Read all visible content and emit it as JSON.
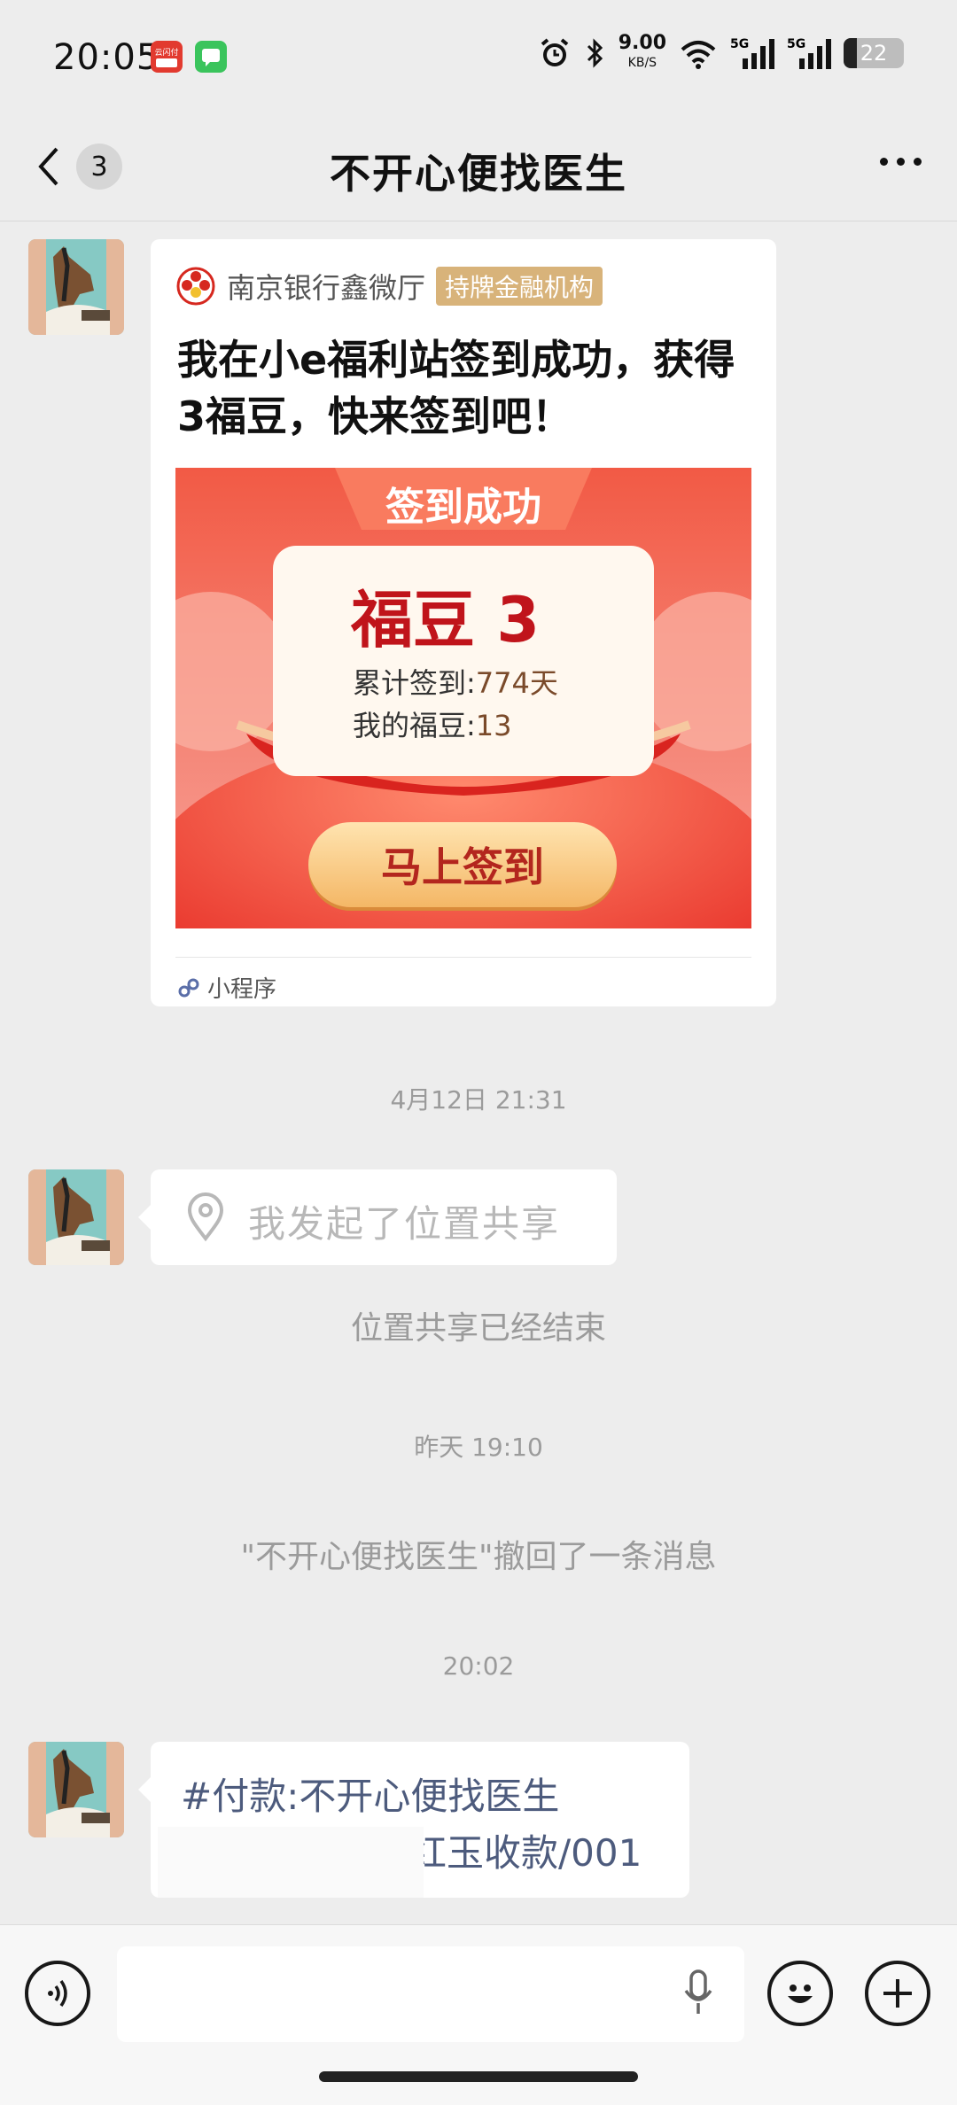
{
  "status_bar": {
    "time": "20:05",
    "app1_label": "云闪付",
    "net_speed": "9.00",
    "net_unit": "KB/S",
    "signal1": "5G",
    "signal2": "5G",
    "battery": "22",
    "battery_fraction": 0.22
  },
  "header": {
    "unread_count": "3",
    "title": "不开心便找医生"
  },
  "card": {
    "source_name": "南京银行鑫微厅",
    "source_badge": "持牌金融机构",
    "text": "我在小e福利站签到成功，获得3福豆，快来签到吧！",
    "image": {
      "banner": "签到成功",
      "fudou": "福豆 3",
      "cum_label": "累计签到:",
      "cum_value": "774天",
      "my_label": "我的福豆:",
      "my_value": "13",
      "button": "马上签到"
    },
    "footer": "小程序"
  },
  "timestamp_1": "4月12日 21:31",
  "location_share": "我发起了位置共享",
  "location_ended": "位置共享已经结束",
  "timestamp_2": "昨天 19:10",
  "recalled": "\"不开心便找医生\"撤回了一条消息",
  "timestamp_3": "20:02",
  "pay_message": {
    "line1": "#付款:不开心便找医生",
    "line2": "红玉收款/001"
  },
  "colors": {
    "background": "#ededed",
    "badge": "#d8b37a",
    "pay_text": "#4d5b7d",
    "system_text": "#9b9b9b"
  }
}
